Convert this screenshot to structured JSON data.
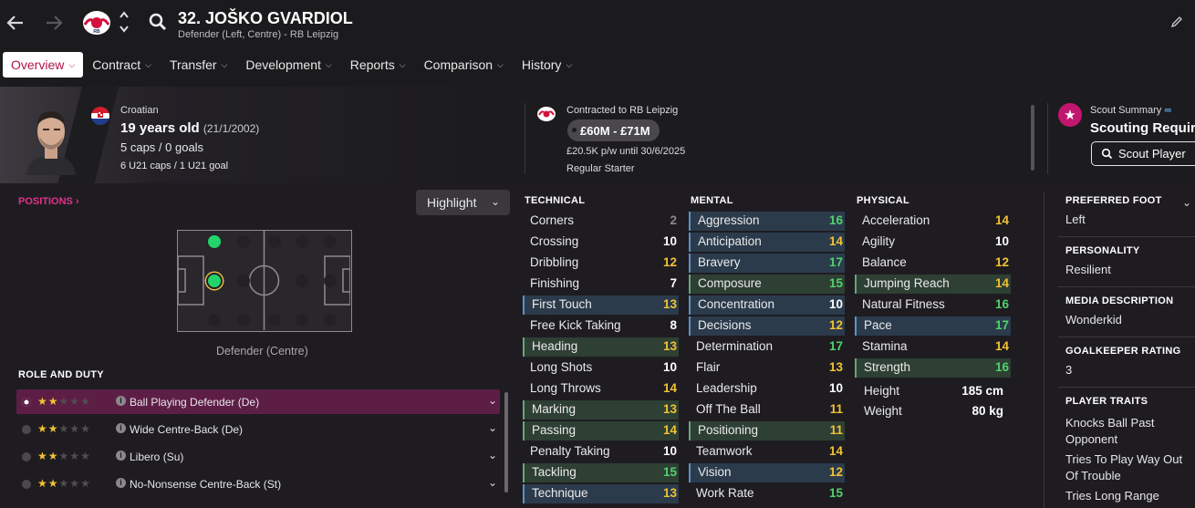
{
  "header": {
    "player_name": "32. JOŠKO GVARDIOL",
    "subtitle": "Defender (Left, Centre) - RB Leipzig"
  },
  "tabs": [
    {
      "label": "Overview"
    },
    {
      "label": "Contract"
    },
    {
      "label": "Transfer"
    },
    {
      "label": "Development"
    },
    {
      "label": "Reports"
    },
    {
      "label": "Comparison"
    },
    {
      "label": "History"
    }
  ],
  "bio": {
    "nationality": "Croatian",
    "age": "19 years old",
    "dob": "(21/1/2002)",
    "caps": "5 caps / 0 goals",
    "u21": "6 U21 caps / 1 U21 goal"
  },
  "contract": {
    "title": "Contracted to RB Leipzig",
    "value": "£60M - £71M",
    "wage": "£20.5K p/w until 30/6/2025",
    "status": "Regular Starter"
  },
  "scout": {
    "title": "Scout Summary",
    "requirement": "Scouting Require",
    "button": "Scout Player"
  },
  "positions": {
    "header": "POSITIONS",
    "selector": "Highlight",
    "label": "Defender (Centre)"
  },
  "roles": {
    "header": "ROLE AND DUTY",
    "items": [
      {
        "name": "Ball Playing Defender (De)",
        "stars": 2
      },
      {
        "name": "Wide Centre-Back (De)",
        "stars": 2
      },
      {
        "name": "Libero (Su)",
        "stars": 2
      },
      {
        "name": "No-Nonsense Centre-Back (St)",
        "stars": 2
      }
    ]
  },
  "attributes": {
    "technical_header": "TECHNICAL",
    "mental_header": "MENTAL",
    "physical_header": "PHYSICAL",
    "technical": [
      {
        "name": "Corners",
        "value": "2",
        "hl": ""
      },
      {
        "name": "Crossing",
        "value": "10",
        "hl": ""
      },
      {
        "name": "Dribbling",
        "value": "12",
        "hl": ""
      },
      {
        "name": "Finishing",
        "value": "7",
        "hl": ""
      },
      {
        "name": "First Touch",
        "value": "13",
        "hl": "blue"
      },
      {
        "name": "Free Kick Taking",
        "value": "8",
        "hl": ""
      },
      {
        "name": "Heading",
        "value": "13",
        "hl": "green"
      },
      {
        "name": "Long Shots",
        "value": "10",
        "hl": ""
      },
      {
        "name": "Long Throws",
        "value": "14",
        "hl": ""
      },
      {
        "name": "Marking",
        "value": "13",
        "hl": "green"
      },
      {
        "name": "Passing",
        "value": "14",
        "hl": "green"
      },
      {
        "name": "Penalty Taking",
        "value": "10",
        "hl": ""
      },
      {
        "name": "Tackling",
        "value": "15",
        "hl": "green"
      },
      {
        "name": "Technique",
        "value": "13",
        "hl": "blue"
      }
    ],
    "mental": [
      {
        "name": "Aggression",
        "value": "16",
        "hl": "blue"
      },
      {
        "name": "Anticipation",
        "value": "14",
        "hl": "blue"
      },
      {
        "name": "Bravery",
        "value": "17",
        "hl": "blue"
      },
      {
        "name": "Composure",
        "value": "15",
        "hl": "green"
      },
      {
        "name": "Concentration",
        "value": "10",
        "hl": "blue"
      },
      {
        "name": "Decisions",
        "value": "12",
        "hl": "blue"
      },
      {
        "name": "Determination",
        "value": "17",
        "hl": ""
      },
      {
        "name": "Flair",
        "value": "13",
        "hl": ""
      },
      {
        "name": "Leadership",
        "value": "10",
        "hl": ""
      },
      {
        "name": "Off The Ball",
        "value": "11",
        "hl": ""
      },
      {
        "name": "Positioning",
        "value": "11",
        "hl": "green"
      },
      {
        "name": "Teamwork",
        "value": "14",
        "hl": ""
      },
      {
        "name": "Vision",
        "value": "12",
        "hl": "blue"
      },
      {
        "name": "Work Rate",
        "value": "15",
        "hl": ""
      }
    ],
    "physical": [
      {
        "name": "Acceleration",
        "value": "14",
        "hl": ""
      },
      {
        "name": "Agility",
        "value": "10",
        "hl": ""
      },
      {
        "name": "Balance",
        "value": "12",
        "hl": ""
      },
      {
        "name": "Jumping Reach",
        "value": "14",
        "hl": "green"
      },
      {
        "name": "Natural Fitness",
        "value": "16",
        "hl": ""
      },
      {
        "name": "Pace",
        "value": "17",
        "hl": "blue"
      },
      {
        "name": "Stamina",
        "value": "14",
        "hl": ""
      },
      {
        "name": "Strength",
        "value": "16",
        "hl": "green"
      }
    ],
    "height_label": "Height",
    "height": "185 cm",
    "weight_label": "Weight",
    "weight": "80 kg"
  },
  "info_panel": {
    "foot_h": "PREFERRED FOOT",
    "foot": "Left",
    "personality_h": "PERSONALITY",
    "personality": "Resilient",
    "media_h": "MEDIA DESCRIPTION",
    "media": "Wonderkid",
    "gk_h": "GOALKEEPER RATING",
    "gk": "3",
    "traits_h": "PLAYER TRAITS",
    "traits": [
      "Knocks Ball Past Opponent",
      "Tries To Play Way Out Of Trouble",
      "Tries Long Range"
    ]
  },
  "colors": {
    "accent": "#b2124a",
    "highlight_blue": "#5b93c6",
    "highlight_green": "#67a67a",
    "value_green": "#4fd36b",
    "value_yellow": "#f1c232"
  }
}
